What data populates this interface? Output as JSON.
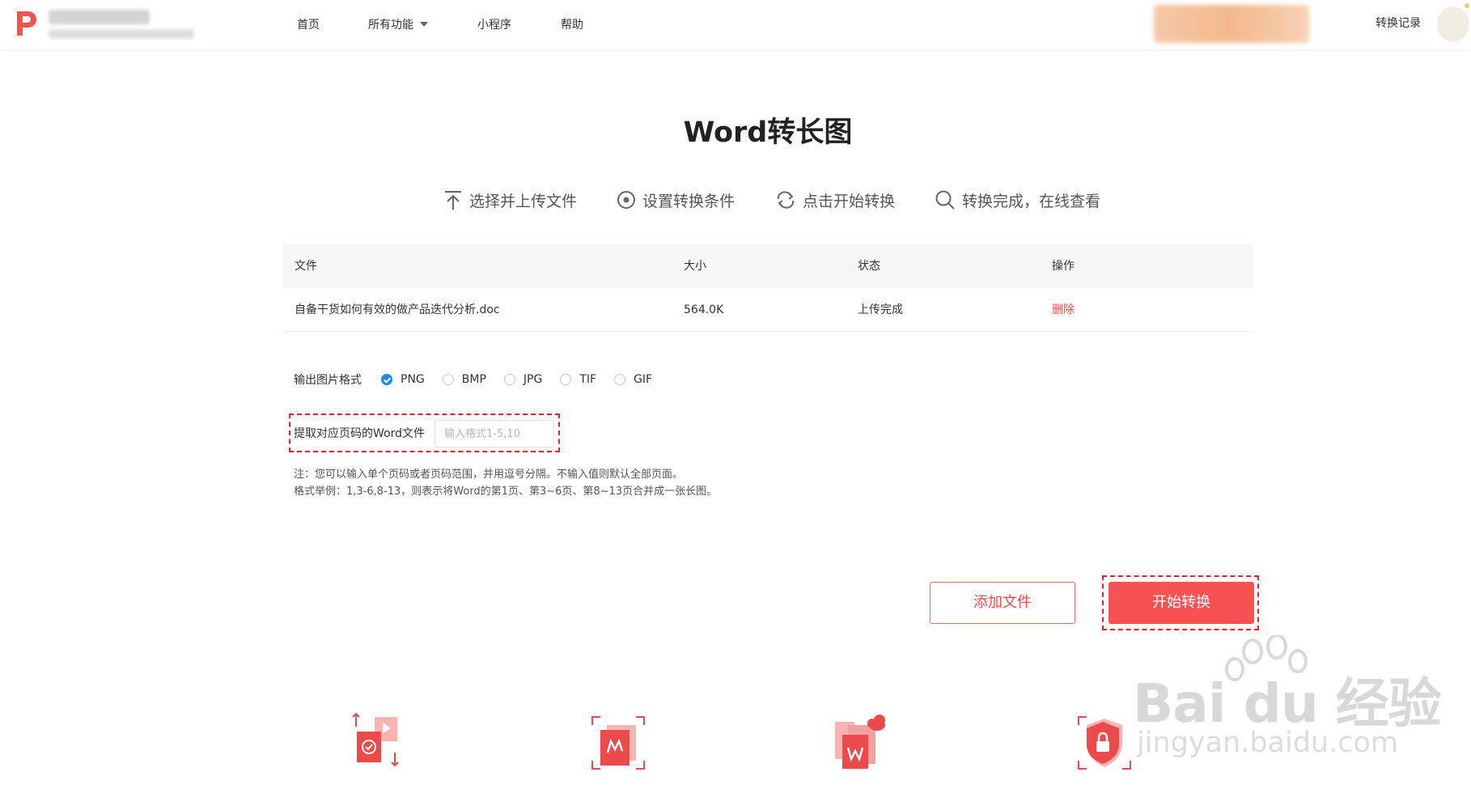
{
  "header": {
    "nav": [
      "首页",
      "所有功能",
      "小程序",
      "帮助"
    ],
    "history_label": "转换记录"
  },
  "main": {
    "title": "Word转长图",
    "steps": [
      "选择并上传文件",
      "设置转换条件",
      "点击开始转换",
      "转换完成，在线查看"
    ]
  },
  "table": {
    "headers": [
      "文件",
      "大小",
      "状态",
      "操作"
    ],
    "rows": [
      {
        "name": "自备干货如何有效的做产品迭代分析.doc",
        "size": "564.0K",
        "status": "上传完成",
        "action": "删除"
      }
    ]
  },
  "format": {
    "label": "输出图片格式",
    "options": [
      "PNG",
      "BMP",
      "JPG",
      "TIF",
      "GIF"
    ],
    "selected": "PNG"
  },
  "pages": {
    "label": "提取对应页码的Word文件",
    "placeholder": "输入格式1-5,10",
    "note_1": "注：您可以输入单个页码或者页码范围，并用逗号分隔。不输入值则默认全部页面。",
    "note_2": "格式举例：1,3-6,8-13，则表示将Word的第1页、第3~6页、第8~13页合并成一张长图。"
  },
  "buttons": {
    "add": "添加文件",
    "start": "开始转换"
  },
  "watermark": {
    "text": "Bai du 经验",
    "url": "jingyan.baidu.com"
  },
  "colors": {
    "accent": "#f65253",
    "check": "#1f86f5",
    "highlight_border": "#e0232a"
  }
}
